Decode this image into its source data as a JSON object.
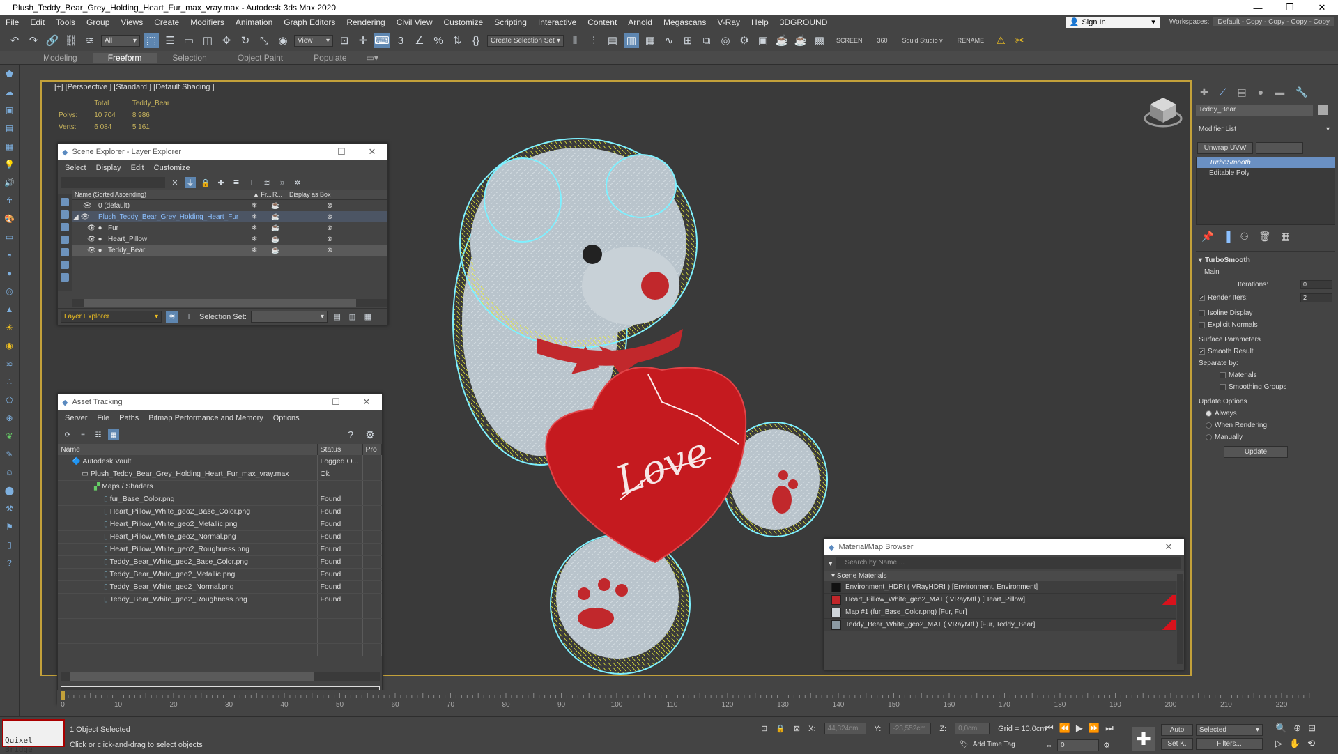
{
  "window": {
    "title": "Plush_Teddy_Bear_Grey_Holding_Heart_Fur_max_vray.max - Autodesk 3ds Max 2020"
  },
  "menu": [
    "File",
    "Edit",
    "Tools",
    "Group",
    "Views",
    "Create",
    "Modifiers",
    "Animation",
    "Graph Editors",
    "Rendering",
    "Civil View",
    "Customize",
    "Scripting",
    "Interactive",
    "Content",
    "Arnold",
    "Megascans",
    "V-Ray",
    "Help",
    "3DGROUND"
  ],
  "signin": "Sign In",
  "workspaces": {
    "label": "Workspaces:",
    "value": "Default - Copy - Copy - Copy - Copy"
  },
  "toolbar": {
    "filter": "All",
    "view": "View",
    "selset": "Create Selection Set",
    "screen": "SCREEN",
    "deg": "360",
    "squid": "Squid Studio v",
    "rename": "RENAME"
  },
  "ribbon": [
    "Modeling",
    "Freeform",
    "Selection",
    "Object Paint",
    "Populate"
  ],
  "viewport": {
    "label": "[+] [Perspective ] [Standard ] [Default Shading ]",
    "stats": {
      "h_total": "Total",
      "h_obj": "Teddy_Bear",
      "polys_label": "Polys:",
      "polys_total": "10 704",
      "polys_obj": "8 986",
      "verts_label": "Verts:",
      "verts_total": "6 084",
      "verts_obj": "5 161"
    },
    "love": "Love"
  },
  "scene_explorer": {
    "title": "Scene Explorer - Layer Explorer",
    "menu": [
      "Select",
      "Display",
      "Edit",
      "Customize"
    ],
    "cols": {
      "name": "Name (Sorted Ascending)",
      "fr": "▲ Fr...",
      "r": "R...",
      "box": "Display as Box"
    },
    "rows": [
      "0 (default)",
      "Plush_Teddy_Bear_Grey_Holding_Heart_Fur",
      "Fur",
      "Heart_Pillow",
      "Teddy_Bear"
    ],
    "explorer": "Layer Explorer",
    "selset": "Selection Set:"
  },
  "asset_tracking": {
    "title": "Asset Tracking",
    "menu": [
      "Server",
      "File",
      "Paths",
      "Bitmap Performance and Memory",
      "Options"
    ],
    "cols": [
      "Name",
      "Status",
      "Pro"
    ],
    "rows": [
      {
        "name": "Autodesk Vault",
        "status": "Logged O..."
      },
      {
        "name": "Plush_Teddy_Bear_Grey_Holding_Heart_Fur_max_vray.max",
        "status": "Ok"
      },
      {
        "name": "Maps / Shaders",
        "status": ""
      },
      {
        "name": "fur_Base_Color.png",
        "status": "Found"
      },
      {
        "name": "Heart_Pillow_White_geo2_Base_Color.png",
        "status": "Found"
      },
      {
        "name": "Heart_Pillow_White_geo2_Metallic.png",
        "status": "Found"
      },
      {
        "name": "Heart_Pillow_White_geo2_Normal.png",
        "status": "Found"
      },
      {
        "name": "Heart_Pillow_White_geo2_Roughness.png",
        "status": "Found"
      },
      {
        "name": "Teddy_Bear_White_geo2_Base_Color.png",
        "status": "Found"
      },
      {
        "name": "Teddy_Bear_White_geo2_Metallic.png",
        "status": "Found"
      },
      {
        "name": "Teddy_Bear_White_geo2_Normal.png",
        "status": "Found"
      },
      {
        "name": "Teddy_Bear_White_geo2_Roughness.png",
        "status": "Found"
      }
    ]
  },
  "mat_browser": {
    "title": "Material/Map Browser",
    "search": "Search by Name ...",
    "section": "Scene Materials",
    "rows": [
      {
        "label": "Environment_HDRI  ( VRayHDRI )  [Environment, Environment]",
        "color": "#111111"
      },
      {
        "label": "Heart_Pillow_White_geo2_MAT  ( VRayMtl )  [Heart_Pillow]",
        "color": "#c0262a"
      },
      {
        "label": "Map #1 (fur_Base_Color.png)  [Fur, Fur]",
        "color": "#cfd5da"
      },
      {
        "label": "Teddy_Bear_White_geo2_MAT  ( VRayMtl )  [Fur, Teddy_Bear]",
        "color": "#8c9aa3"
      }
    ]
  },
  "command_panel": {
    "object": "Teddy_Bear",
    "modlist": "Modifier List",
    "unwrap": "Unwrap UVW",
    "stack": [
      "TurboSmooth",
      "Editable Poly"
    ],
    "rollout": "TurboSmooth",
    "main": "Main",
    "iterations_label": "Iterations:",
    "iterations": "0",
    "render_iters_label": "Render Iters:",
    "render_iters": "2",
    "isoline": "Isoline Display",
    "explicit": "Explicit Normals",
    "surface": "Surface Parameters",
    "smooth": "Smooth Result",
    "separate": "Separate by:",
    "materials": "Materials",
    "groups": "Smoothing Groups",
    "update_options": "Update Options",
    "always": "Always",
    "when_rendering": "When Rendering",
    "manually": "Manually",
    "update": "Update"
  },
  "timeline": {
    "ticks": [
      "0",
      "10",
      "20",
      "30",
      "40",
      "50",
      "60",
      "70",
      "80",
      "90",
      "100",
      "110",
      "120",
      "130",
      "140",
      "150",
      "160",
      "170",
      "180",
      "190",
      "200",
      "210",
      "220"
    ]
  },
  "status": {
    "selected": "1 Object Selected",
    "hint": "Click or click-and-drag to select objects",
    "x_label": "X:",
    "x": "44,324cm",
    "y_label": "Y:",
    "y": "-23,552cm",
    "z_label": "Z:",
    "z": "0,0cm",
    "grid": "Grid = 10,0cm",
    "addtag": "Add Time Tag",
    "auto": "Auto",
    "setk": "Set K.",
    "sel": "Selected",
    "filters": "Filters...",
    "frame": "0",
    "logo": "Quixel Bridge"
  }
}
